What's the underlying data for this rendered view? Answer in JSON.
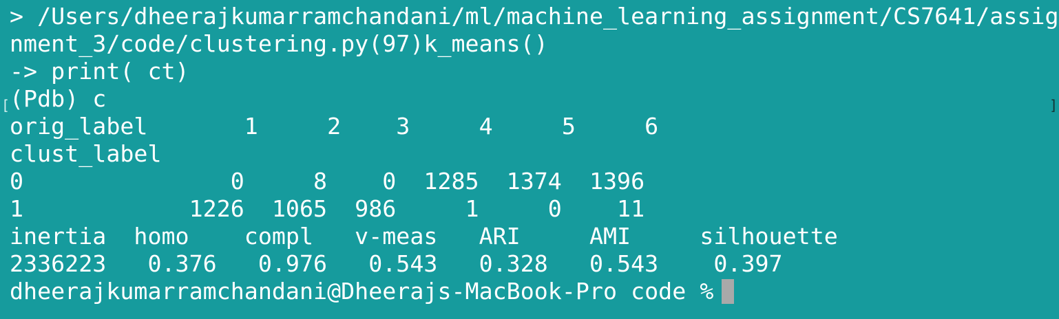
{
  "terminal": {
    "lines": [
      "> /Users/dheerajkumarramchandani/ml/machine_learning_assignment/CS7641/assig",
      "nment_3/code/clustering.py(97)k_means()",
      "-> print( ct)",
      "(Pdb) c",
      "orig_label       1     2    3     4     5     6",
      "clust_label",
      "0               0     8    0  1285  1374  1396",
      "1            1226  1065  986     1     0    11",
      "inertia  homo    compl   v-meas   ARI     AMI     silhouette",
      "2336223   0.376   0.976   0.543   0.328   0.543    0.397",
      "dheerajkumarramchandani@Dheerajs-MacBook-Pro code %"
    ],
    "cursor_color": "#a9a9a9",
    "background_color": "#169b9d",
    "text_color": "#ffffff"
  }
}
